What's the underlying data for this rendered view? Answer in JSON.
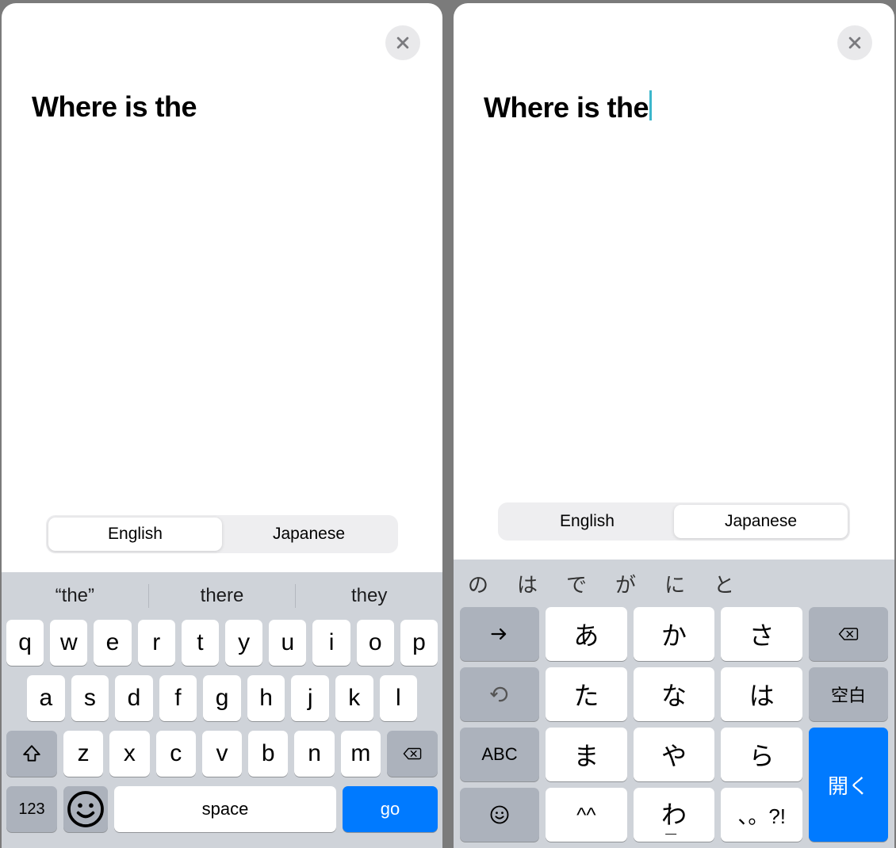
{
  "left": {
    "text": "Where is the",
    "lang1": "English",
    "lang2": "Japanese",
    "suggestions": [
      "“the”",
      "there",
      "they"
    ],
    "rows": {
      "r1": [
        "q",
        "w",
        "e",
        "r",
        "t",
        "y",
        "u",
        "i",
        "o",
        "p"
      ],
      "r2": [
        "a",
        "s",
        "d",
        "f",
        "g",
        "h",
        "j",
        "k",
        "l"
      ],
      "r3": [
        "z",
        "x",
        "c",
        "v",
        "b",
        "n",
        "m"
      ]
    },
    "numKey": "123",
    "spaceKey": "space",
    "goKey": "go"
  },
  "right": {
    "text": "Where is the",
    "lang1": "English",
    "lang2": "Japanese",
    "suggestions": [
      "の",
      "は",
      "で",
      "が",
      "に",
      "と"
    ],
    "kana": {
      "r1": [
        "あ",
        "か",
        "さ"
      ],
      "r2": [
        "た",
        "な",
        "は"
      ],
      "r3": [
        "ま",
        "や",
        "ら"
      ],
      "r4_center": "わ"
    },
    "abcKey": "ABC",
    "spaceKey": "空白",
    "openKey": "開く",
    "facesKey": "^^",
    "punctKey": "、。?!"
  }
}
